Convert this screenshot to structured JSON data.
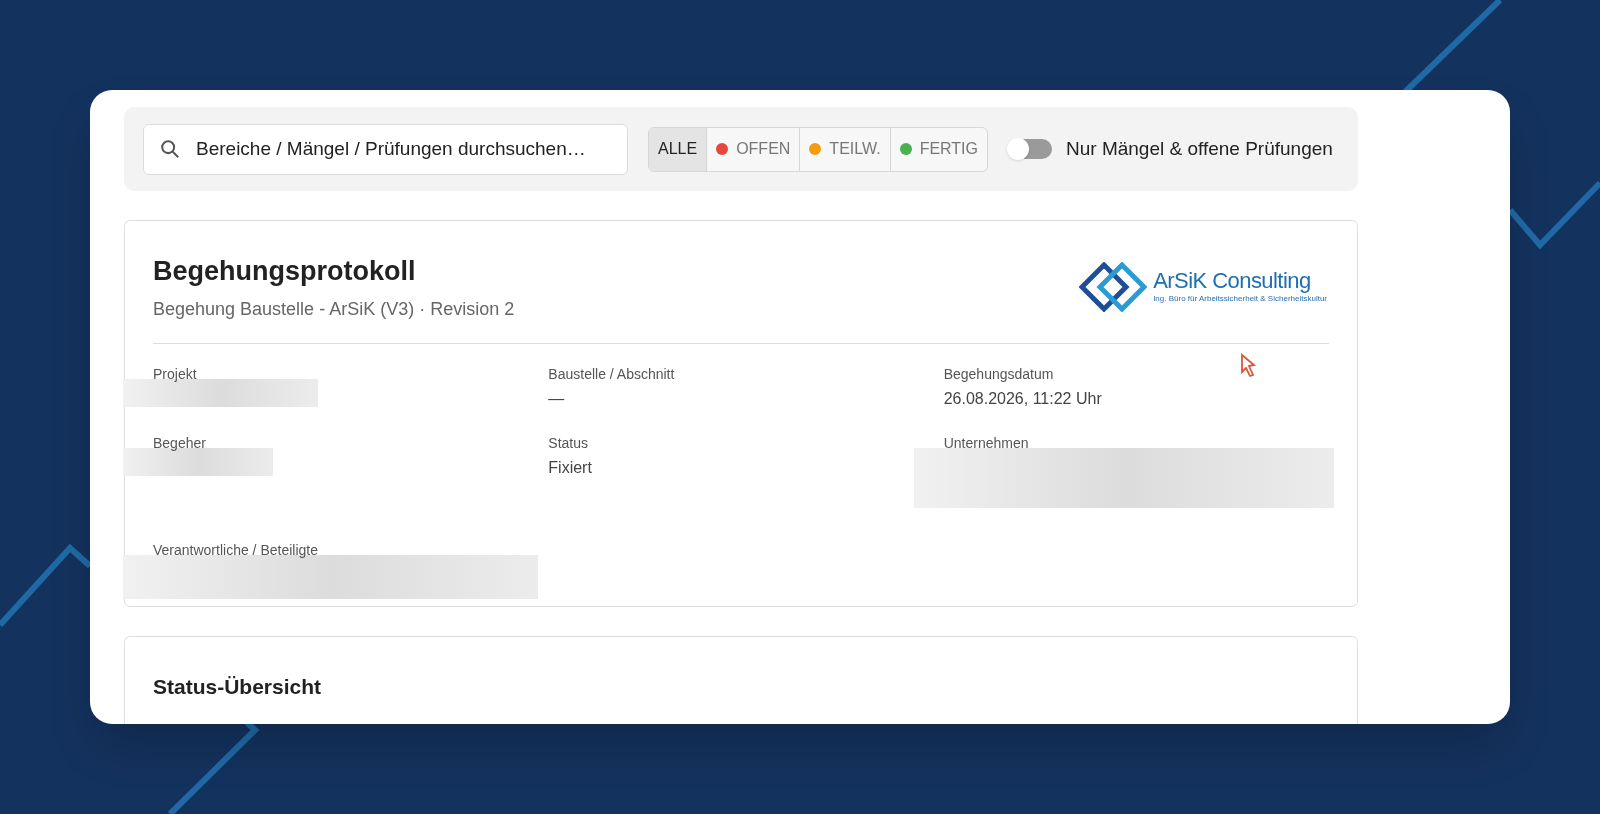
{
  "search": {
    "placeholder": "Bereiche / Mängel / Prüfungen durchsuchen…"
  },
  "filters": [
    {
      "label": "ALLE",
      "selected": true
    },
    {
      "label": "OFFEN",
      "color": "#e8453c",
      "selected": false
    },
    {
      "label": "TEILW.",
      "color": "#f39c12",
      "selected": false
    },
    {
      "label": "FERTIG",
      "color": "#4caf50",
      "selected": false
    }
  ],
  "toggle": {
    "label": "Nur Mängel & offene Prüfungen",
    "on": false
  },
  "protocol": {
    "title": "Begehungsprotokoll",
    "subtitle": "Begehung Baustelle - ArSiK (V3) · Revision 2",
    "logo": {
      "name": "ArSiK Consulting",
      "tagline": "Ing. Büro für Arbeitssicherheit & Sicherheitskultur"
    },
    "fields": [
      {
        "label": "Projekt",
        "redacted": true
      },
      {
        "label": "Baustelle / Abschnitt",
        "value": "—"
      },
      {
        "label": "Begehungsdatum",
        "value": "26.08.2026, 11:22 Uhr"
      },
      {
        "label": "Begeher",
        "redacted": true
      },
      {
        "label": "Status",
        "value": "Fixiert"
      },
      {
        "label": "Unternehmen",
        "redacted": true
      },
      {
        "label": "Verantwortliche / Beteiligte",
        "redacted": true
      }
    ]
  },
  "overview": {
    "title": "Status-Übersicht"
  }
}
